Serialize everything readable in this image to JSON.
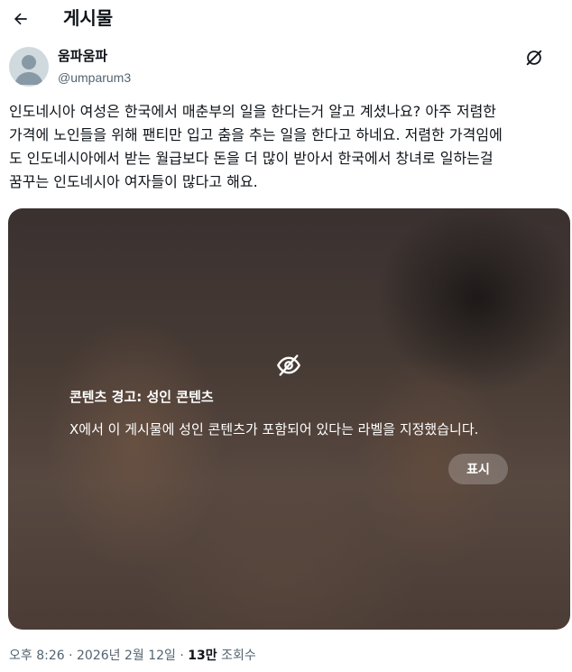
{
  "header": {
    "title": "게시물",
    "back_icon": "arrow-left-icon"
  },
  "author": {
    "name": "움파움파",
    "handle": "@umparum3",
    "avatar_icon": "default-avatar-icon"
  },
  "more_icon": "grok-slash-icon",
  "tweet": {
    "text": "인도네시아 여성은 한국에서 매춘부의 일을 한다는거 알고 계셨나요? 아주 저렴한\n가격에 노인들을 위해 팬티만 입고 춤을 추는 일을 한다고 하네요. 저렴한 가격임에\n도 인도네시아에서 받는 월급보다 돈을 더 많이 받아서 한국에서 창녀로 일하는걸\n꿈꾸는 인도네시아 여자들이 많다고 해요."
  },
  "media": {
    "warning_icon": "eye-slash-icon",
    "warning_title": "콘텐츠 경고: 성인 콘텐츠",
    "warning_desc": "X에서 이 게시물에 성인 콘텐츠가 포함되어 있다는 라벨을 지정했습니다.",
    "show_button": "표시"
  },
  "meta": {
    "time": "오후 8:26",
    "sep1": " · ",
    "date": "2026년 2월 12일",
    "sep2": " · ",
    "views_count": "13만",
    "views_label": " 조회수"
  },
  "colors": {
    "text": "#0f1419",
    "muted": "#536471",
    "avatar_bg": "#cfd9de"
  }
}
